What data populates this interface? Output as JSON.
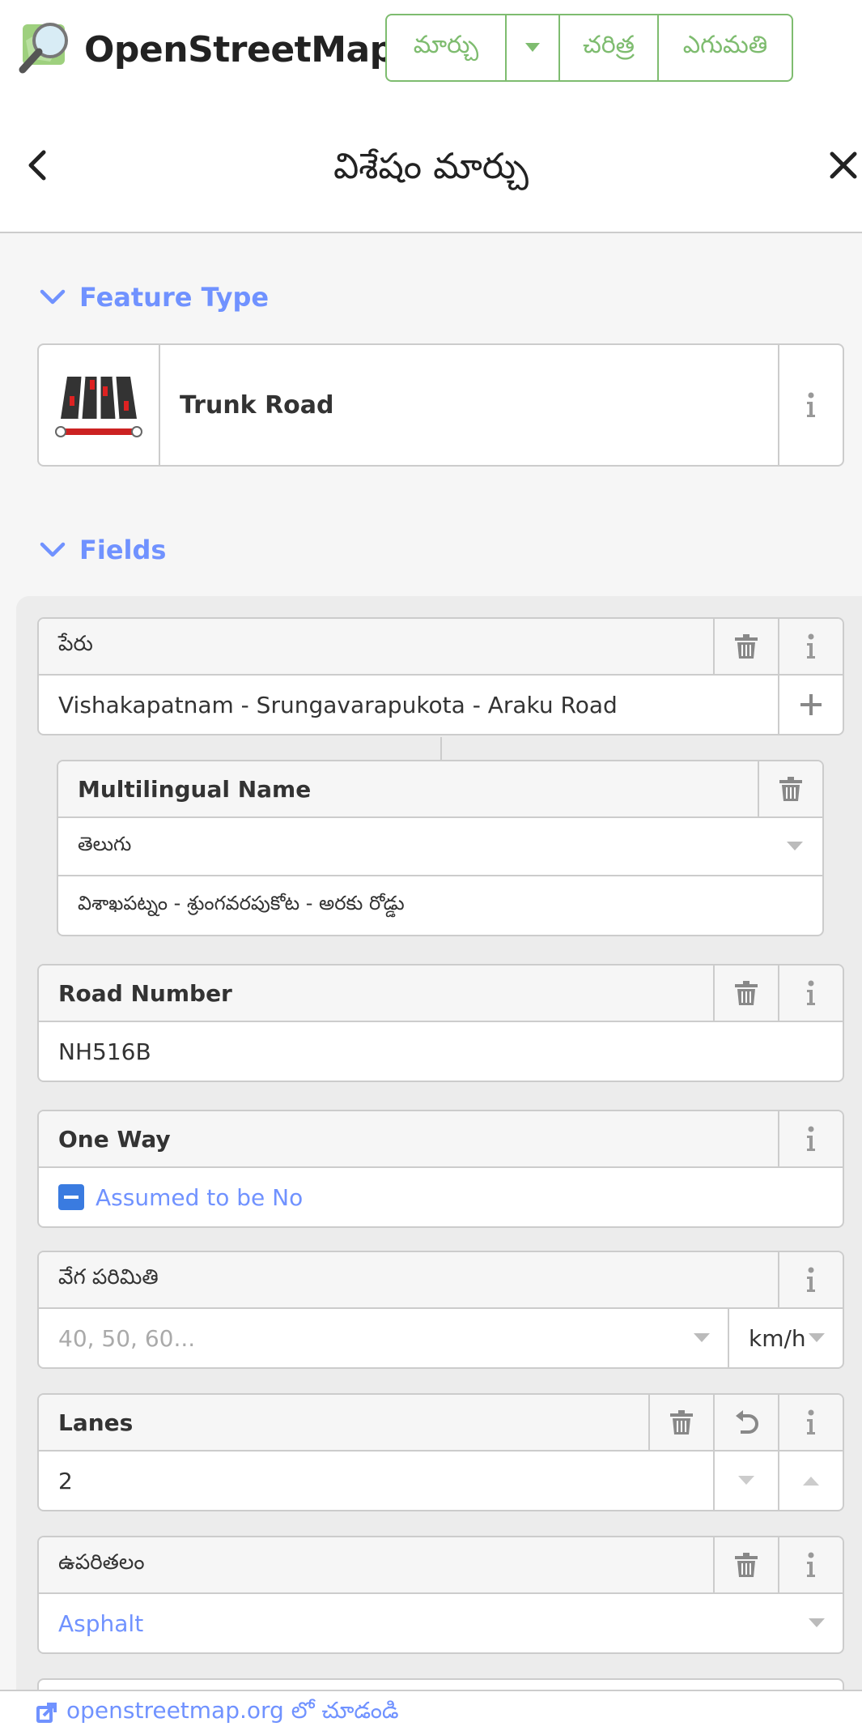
{
  "app": {
    "name": "OpenStreetMap"
  },
  "nav": {
    "edit": "మార్చు",
    "history": "చరిత్ర",
    "export": "ఎగుమతి"
  },
  "sidebar": {
    "title": "విశేషం మార్చు"
  },
  "sections": {
    "feature_type": "Feature Type",
    "fields": "Fields"
  },
  "feature": {
    "type": "Trunk Road"
  },
  "fields": {
    "name": {
      "label": "పేరు",
      "value": "Vishakapatnam - Srungavarapukota - Araku Road",
      "multilingual": {
        "label": "Multilingual Name",
        "language": "తెలుగు",
        "value": "విశాఖపట్నం - శ్రుంగవరపుకోట - అరకు రోడ్డు"
      }
    },
    "road_number": {
      "label": "Road Number",
      "value": "NH516B"
    },
    "oneway": {
      "label": "One Way",
      "value": "Assumed to be No"
    },
    "maxspeed": {
      "label": "వేగ పరిమితి",
      "placeholder": "40, 50, 60...",
      "unit": "km/h"
    },
    "lanes": {
      "label": "Lanes",
      "value": "2"
    },
    "surface": {
      "label": "ఉపరితలం",
      "value": "Asphalt"
    }
  },
  "footer": {
    "link": "openstreetmap.org లో చూడండి"
  },
  "colors": {
    "brand_green": "#7ebc6f",
    "link_blue": "#7092ff"
  }
}
